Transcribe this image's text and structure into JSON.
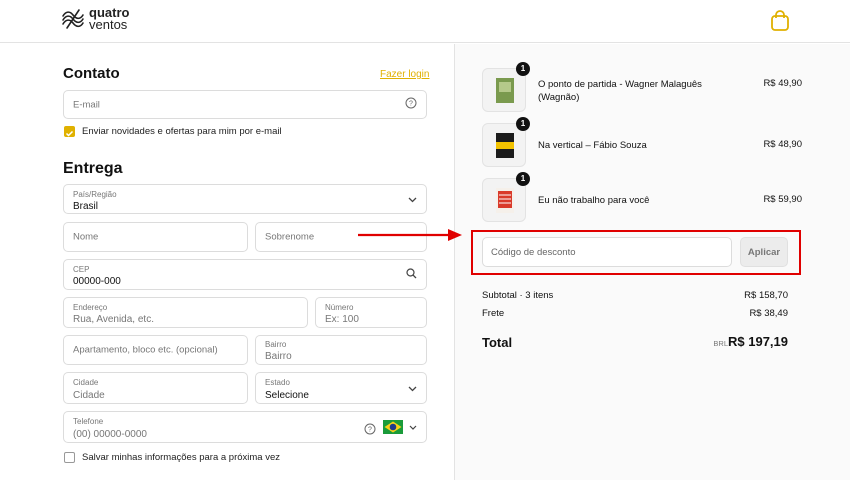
{
  "brand": {
    "line1": "quatro",
    "line2": "ventos"
  },
  "colors": {
    "accent": "#e0b100",
    "highlight": "#e00000"
  },
  "contact": {
    "title": "Contato",
    "login_link": "Fazer login",
    "email_placeholder": "E-mail",
    "newsletter_label": "Enviar novidades e ofertas para mim por e-mail",
    "newsletter_checked": true
  },
  "delivery": {
    "title": "Entrega",
    "country_label": "País/Região",
    "country_value": "Brasil",
    "first_name_placeholder": "Nome",
    "last_name_placeholder": "Sobrenome",
    "cep_label": "CEP",
    "cep_value": "00000-000",
    "address_label": "Endereço",
    "address_value": "Rua, Avenida, etc.",
    "number_label": "Número",
    "number_value": "Ex: 100",
    "apartment_placeholder": "Apartamento, bloco etc. (opcional)",
    "neighborhood_label": "Bairro",
    "neighborhood_value": "Bairro",
    "city_label": "Cidade",
    "city_value": "Cidade",
    "state_label": "Estado",
    "state_value": "Selecione",
    "phone_label": "Telefone",
    "phone_value": "(00) 00000-0000",
    "save_info_label": "Salvar minhas informações para a próxima vez"
  },
  "cart": {
    "items": [
      {
        "qty": "1",
        "name": "O ponto de partida - Wagner Malaguês (Wagnão)",
        "price": "R$ 49,90"
      },
      {
        "qty": "1",
        "name": "Na vertical – Fábio Souza",
        "price": "R$ 48,90"
      },
      {
        "qty": "1",
        "name": "Eu não trabalho para você",
        "price": "R$ 59,90"
      }
    ],
    "discount_placeholder": "Código de desconto",
    "apply_label": "Aplicar",
    "subtotal_label": "Subtotal · 3 itens",
    "subtotal_value": "R$ 158,70",
    "shipping_label": "Frete",
    "shipping_value": "R$ 38,49",
    "total_label": "Total",
    "total_currency": "BRL",
    "total_value": "R$ 197,19"
  }
}
